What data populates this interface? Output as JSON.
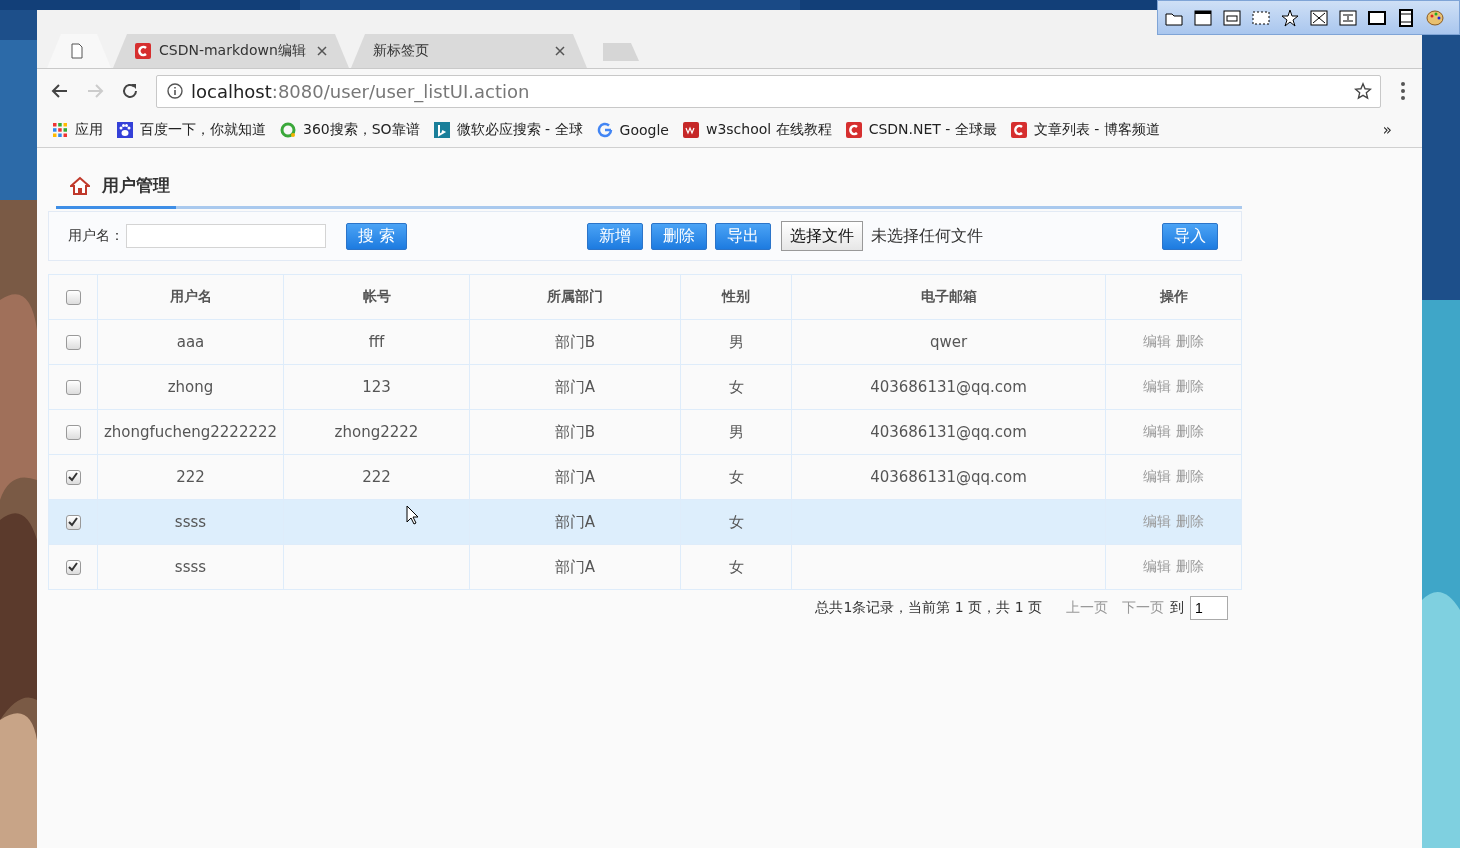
{
  "browser": {
    "tabs": [
      {
        "kind": "page",
        "selected": true
      },
      {
        "kind": "csdn",
        "label": "CSDN-markdown编辑",
        "selected": false
      },
      {
        "kind": "none",
        "label": "新标签页",
        "selected": false
      }
    ],
    "address": {
      "host": "localhost",
      "path": ":8080/user/user_listUI.action"
    },
    "bookmarks": [
      {
        "kind": "apps",
        "label": "应用"
      },
      {
        "kind": "paw",
        "label": "百度一下，你就知道"
      },
      {
        "kind": "ring",
        "label": "360搜索，SO靠谱"
      },
      {
        "kind": "bing",
        "label": "微软必应搜索 - 全球"
      },
      {
        "kind": "google",
        "label": "Google"
      },
      {
        "kind": "w3",
        "label": "w3school 在线教程"
      },
      {
        "kind": "csdn",
        "label": "CSDN.NET - 全球最"
      },
      {
        "kind": "csdn",
        "label": "文章列表 - 博客频道"
      }
    ],
    "more": "»"
  },
  "page": {
    "title": "用户管理",
    "search": {
      "label": "用户名：",
      "button": "搜 索"
    },
    "actions": [
      "新增",
      "删除",
      "导出"
    ],
    "file": {
      "button": "选择文件",
      "status": "未选择任何文件"
    },
    "import": "导入",
    "table": {
      "all_checked": false,
      "columns": [
        "用户名",
        "帐号",
        "所属部门",
        "性别",
        "电子邮箱",
        "操作"
      ],
      "rows": [
        {
          "checked": false,
          "selected": false,
          "cells": [
            "aaa",
            "fff",
            "部门B",
            "男",
            "qwer"
          ],
          "actions": [
            "编辑",
            "删除"
          ]
        },
        {
          "checked": false,
          "selected": false,
          "cells": [
            "zhong",
            "123",
            "部门A",
            "女",
            "403686131@qq.com"
          ],
          "actions": [
            "编辑",
            "删除"
          ]
        },
        {
          "checked": false,
          "selected": false,
          "cells": [
            "zhongfucheng2222222",
            "zhong2222",
            "部门B",
            "男",
            "403686131@qq.com"
          ],
          "actions": [
            "编辑",
            "删除"
          ]
        },
        {
          "checked": true,
          "selected": false,
          "cells": [
            "222",
            "222",
            "部门A",
            "女",
            "403686131@qq.com"
          ],
          "actions": [
            "编辑",
            "删除"
          ]
        },
        {
          "checked": true,
          "selected": true,
          "cells": [
            "ssss",
            "",
            "部门A",
            "女",
            ""
          ],
          "actions": [
            "编辑",
            "删除"
          ]
        },
        {
          "checked": true,
          "selected": false,
          "cells": [
            "ssss",
            "",
            "部门A",
            "女",
            ""
          ],
          "actions": [
            "编辑",
            "删除"
          ]
        }
      ]
    },
    "pager": {
      "summary": "总共1条记录，当前第 1 页，共 1 页",
      "prev": "上一页",
      "next": "下一页",
      "goto": "到",
      "page": "1"
    }
  }
}
